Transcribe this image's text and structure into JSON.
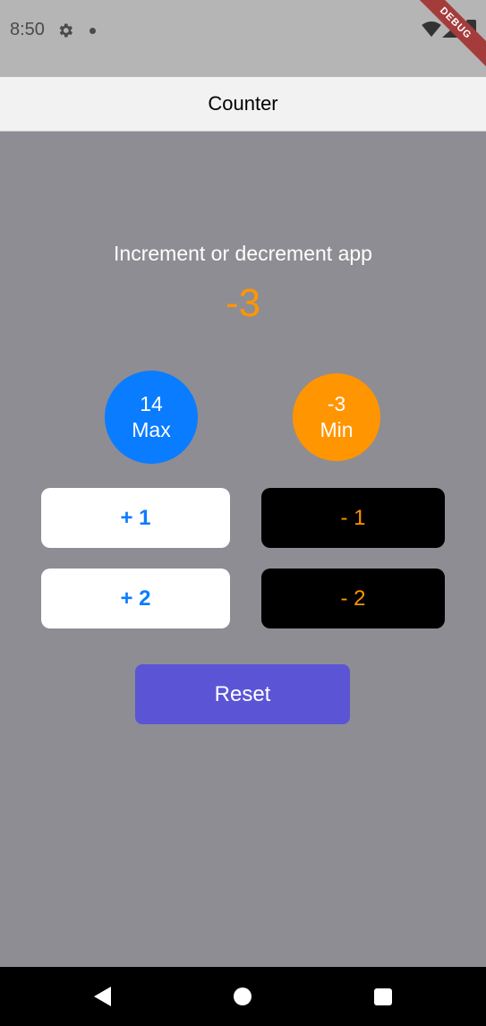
{
  "status_bar": {
    "time": "8:50",
    "debug_label": "DEBUG"
  },
  "app_bar": {
    "title": "Counter"
  },
  "main": {
    "subtitle": "Increment or decrement app",
    "counter_value": "-3",
    "max": {
      "value": "14",
      "label": "Max"
    },
    "min": {
      "value": "-3",
      "label": "Min"
    },
    "buttons": {
      "plus1": "+ 1",
      "plus2": "+ 2",
      "minus1": "- 1",
      "minus2": "- 2",
      "reset": "Reset"
    }
  },
  "colors": {
    "accent_blue": "#0a7cff",
    "accent_orange": "#ff9500",
    "reset_purple": "#5b55d6",
    "background": "#8e8d93"
  },
  "icons": {
    "status": [
      "gear-icon",
      "notification-dot-icon",
      "wifi-icon",
      "signal-icon",
      "battery-icon"
    ],
    "nav": [
      "back-icon",
      "home-icon",
      "recent-apps-icon"
    ]
  }
}
